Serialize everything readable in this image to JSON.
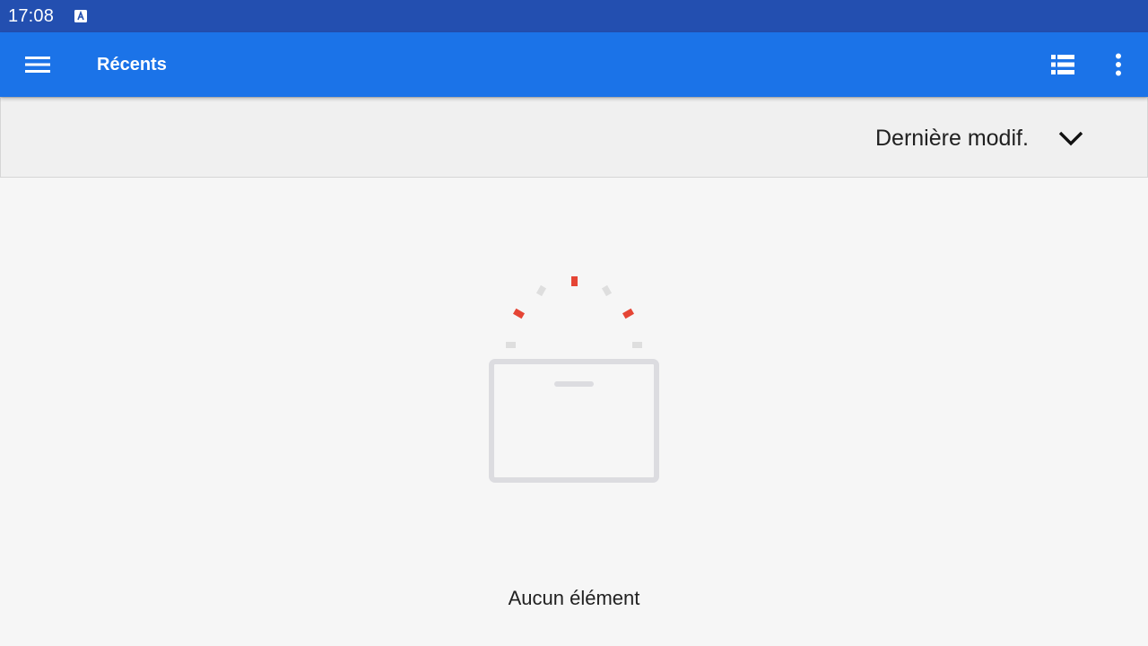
{
  "status_bar": {
    "time": "17:08",
    "notification_icon": "keyboard-a-icon"
  },
  "app_bar": {
    "title": "Récents",
    "menu_icon": "hamburger-menu-icon",
    "view_icon": "list-view-icon",
    "more_icon": "more-vert-icon",
    "background": "#1b73e8"
  },
  "sort": {
    "label": "Dernière modif.",
    "icon": "chevron-down-icon"
  },
  "empty_state": {
    "message": "Aucun élément",
    "illustration": "empty-box-icon",
    "accent_color": "#e54535"
  },
  "colors": {
    "status_bar": "#234fb0",
    "app_bar": "#1b73e8",
    "background": "#f6f6f6"
  }
}
